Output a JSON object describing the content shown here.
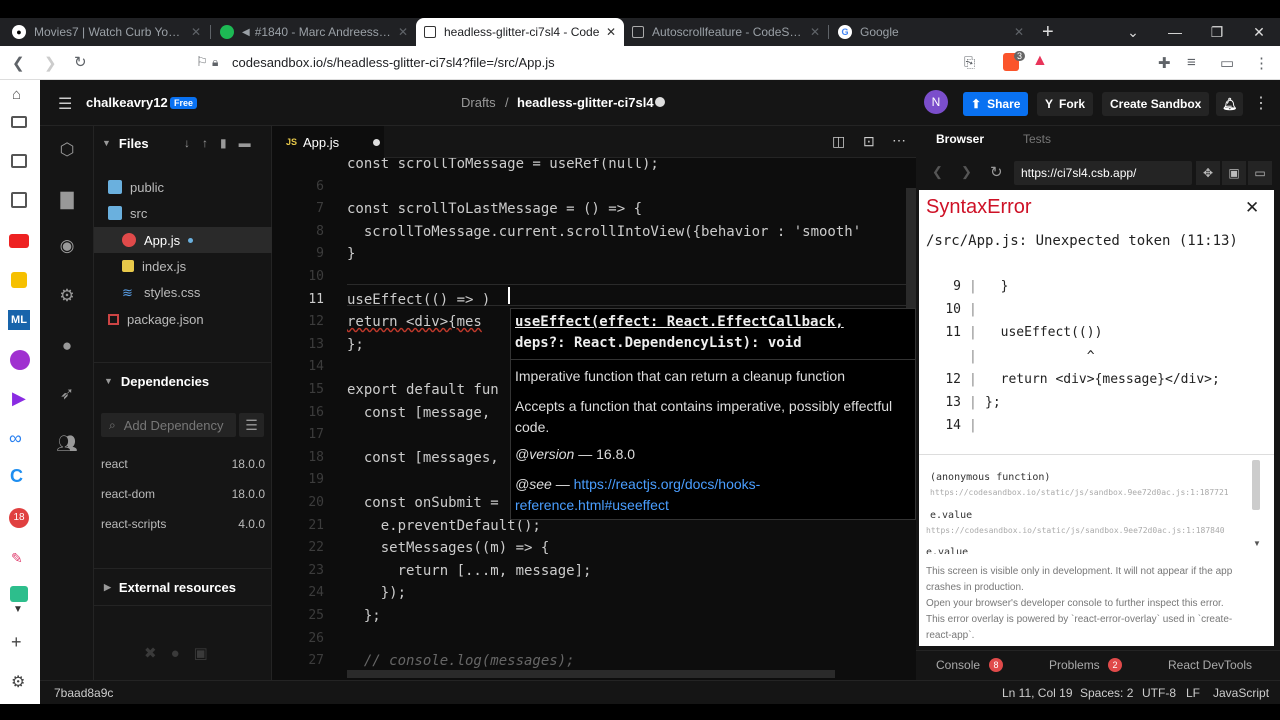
{
  "browser": {
    "tabs": [
      {
        "title": "Movies7 | Watch Curb Your Enthu",
        "favicon": "cb-icon"
      },
      {
        "title": "#1840 - Marc Andreessen • Th",
        "favicon": "spotify-icon"
      },
      {
        "title": "headless-glitter-ci7sl4 - Code",
        "favicon": "codesandbox-icon"
      },
      {
        "title": "Autoscrollfeature - CodeSandbox",
        "favicon": "codesandbox-icon"
      },
      {
        "title": "Google",
        "favicon": "google-icon"
      }
    ],
    "new_tab": "+",
    "url": "codesandbox.io/s/headless-glitter-ci7sl4?file=/src/App.js",
    "ext_badge": "3"
  },
  "header": {
    "user": "chalkeavry12",
    "plan_badge": "Free",
    "breadcrumb_root": "Drafts",
    "breadcrumb_sep": "/",
    "sandbox_name": "headless-glitter-ci7sl4",
    "avatar": "N",
    "share": "Share",
    "fork": "Fork",
    "create": "Create Sandbox"
  },
  "files": {
    "title": "Files",
    "tree": [
      {
        "label": "public",
        "type": "folder"
      },
      {
        "label": "src",
        "type": "folder"
      },
      {
        "label": "App.js",
        "type": "js-error"
      },
      {
        "label": "index.js",
        "type": "js"
      },
      {
        "label": "styles.css",
        "type": "css"
      },
      {
        "label": "package.json",
        "type": "json"
      }
    ],
    "deps_title": "Dependencies",
    "add_dep_placeholder": "Add Dependency",
    "deps": [
      {
        "name": "react",
        "version": "18.0.0"
      },
      {
        "name": "react-dom",
        "version": "18.0.0"
      },
      {
        "name": "react-scripts",
        "version": "4.0.0"
      }
    ],
    "external_title": "External resources"
  },
  "editor": {
    "tab": "App.js",
    "tab_badge": "JS",
    "lines": [
      {
        "n": "",
        "text": "const scrollToMessage = useRef(null);"
      },
      {
        "n": "6",
        "text": ""
      },
      {
        "n": "7",
        "text": "const scrollToLastMessage = () => {"
      },
      {
        "n": "8",
        "text": "  scrollToMessage.current.scrollIntoView({behavior : 'smooth'"
      },
      {
        "n": "9",
        "text": "}"
      },
      {
        "n": "10",
        "text": ""
      },
      {
        "n": "11",
        "text": "useEffect(() => )"
      },
      {
        "n": "12",
        "text": "return <div>{mes"
      },
      {
        "n": "13",
        "text": "};"
      },
      {
        "n": "14",
        "text": ""
      },
      {
        "n": "15",
        "text": "export default fun"
      },
      {
        "n": "16",
        "text": "  const [message,"
      },
      {
        "n": "17",
        "text": ""
      },
      {
        "n": "18",
        "text": "  const [messages,"
      },
      {
        "n": "19",
        "text": ""
      },
      {
        "n": "20",
        "text": "  const onSubmit ="
      },
      {
        "n": "21",
        "text": "    e.preventDefault();"
      },
      {
        "n": "22",
        "text": "    setMessages((m) => {"
      },
      {
        "n": "23",
        "text": "      return [...m, message];"
      },
      {
        "n": "24",
        "text": "    });"
      },
      {
        "n": "25",
        "text": "  };"
      },
      {
        "n": "26",
        "text": ""
      },
      {
        "n": "27",
        "text": "  // console.log(messages);"
      }
    ],
    "hover": {
      "signature1": "useEffect(effect: React.EffectCallback,",
      "signature2": "deps?: React.DependencyList): void",
      "desc1": "Imperative function that can return a cleanup function",
      "desc2": "Accepts a function that contains imperative, possibly effectful code.",
      "version_label": "@version",
      "version": "— 16.8.0",
      "see_label": "@see",
      "see_dash": "—",
      "link1": "https://reactjs.org/docs/hooks-",
      "link2": "reference.html#useeffect"
    }
  },
  "preview": {
    "tabs": [
      "Browser",
      "Tests"
    ],
    "url": "https://ci7sl4.csb.app/",
    "error_title": "SyntaxError",
    "error_msg": "/src/App.js: Unexpected token (11:13)",
    "code": [
      {
        "n": "9",
        "text": "  }"
      },
      {
        "n": "10",
        "text": ""
      },
      {
        "n": "11",
        "text": "  useEffect(())"
      },
      {
        "n": "",
        "text": "             ^"
      },
      {
        "n": "12",
        "text": "  return <div>{message}</div>;"
      },
      {
        "n": "13",
        "text": "};"
      },
      {
        "n": "14",
        "text": ""
      }
    ],
    "stack1": "(anonymous function)",
    "stack1_url": "https://codesandbox.io/static/js/sandbox.9ee72d0ac.js:1:187721",
    "stack2": "e.value",
    "stack2_url": "https://codesandbox.io/static/js/sandbox.9ee72d0ac.js:1:187840",
    "stack3": "e.value",
    "note1": "This screen is visible only in development. It will not appear if the app crashes in production.",
    "note2": "Open your browser's developer console to further inspect this error.",
    "note3": "This error overlay is powered by `react-error-overlay` used in `create-react-app`.",
    "bottom_tabs": [
      {
        "label": "Console",
        "count": "8"
      },
      {
        "label": "Problems",
        "count": "2"
      },
      {
        "label": "React DevTools",
        "count": ""
      }
    ]
  },
  "status": {
    "commit": "7baad8a9c",
    "position": "Ln 11, Col 19",
    "spaces": "Spaces: 2",
    "encoding": "UTF-8",
    "eol": "LF",
    "lang": "JavaScript"
  },
  "colors": {
    "accent": "#0971f1",
    "error": "#ce1126",
    "avatar": "#7b4ecb"
  }
}
